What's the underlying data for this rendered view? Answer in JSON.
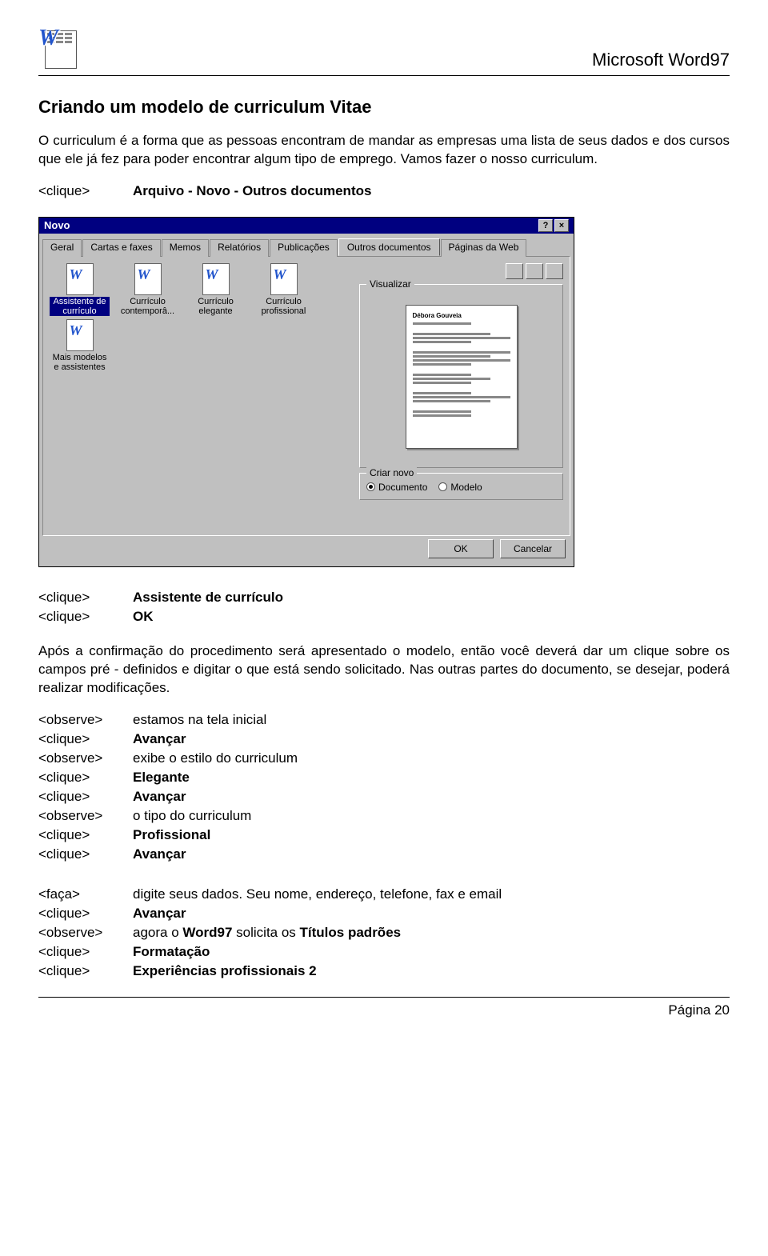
{
  "header": {
    "product": "Microsoft Word97"
  },
  "title": "Criando um modelo de curriculum Vitae",
  "intro": "O curriculum é a forma que as pessoas encontram de mandar as empresas uma lista de seus dados e dos cursos que ele já fez para poder encontrar algum tipo de emprego. Vamos fazer o nosso curriculum.",
  "step1": {
    "tag": "<clique>",
    "val": "Arquivo - Novo - Outros documentos"
  },
  "dialog": {
    "title": "Novo",
    "help_btn": "?",
    "close_btn": "×",
    "tabs": [
      "Geral",
      "Cartas e faxes",
      "Memos",
      "Relatórios",
      "Publicações",
      "Outros documentos",
      "Páginas da Web"
    ],
    "active_tab": 5,
    "templates": [
      {
        "label": "Assistente de currículo",
        "selected": true
      },
      {
        "label": "Currículo contemporâ..."
      },
      {
        "label": "Currículo elegante"
      },
      {
        "label": "Currículo profissional"
      },
      {
        "label": "Mais modelos e assistentes"
      }
    ],
    "preview_label": "Visualizar",
    "preview_name": "Débora Gouveia",
    "create_label": "Criar novo",
    "radio_doc": "Documento",
    "radio_tmpl": "Modelo",
    "ok": "OK",
    "cancel": "Cancelar"
  },
  "step2": [
    {
      "tag": "<clique>",
      "val": "Assistente de currículo",
      "bold": true
    },
    {
      "tag": "<clique>",
      "val": "OK",
      "bold": true
    }
  ],
  "para2": "Após a confirmação do procedimento será apresentado o modelo, então você deverá dar um clique sobre os campos pré - definidos e digitar o que está sendo solicitado. Nas outras partes do documento, se desejar, poderá realizar modificações.",
  "step3": [
    {
      "tag": "<observe>",
      "val": "estamos na tela inicial"
    },
    {
      "tag": "<clique>",
      "val": "Avançar",
      "bold": true
    },
    {
      "tag": "<observe>",
      "val": "exibe o estilo do curriculum"
    },
    {
      "tag": "<clique>",
      "val": "Elegante",
      "bold": true
    },
    {
      "tag": "<clique>",
      "val": "Avançar",
      "bold": true
    },
    {
      "tag": "<observe>",
      "val": "o tipo do curriculum"
    },
    {
      "tag": "<clique>",
      "val": "Profissional",
      "bold": true
    },
    {
      "tag": "<clique>",
      "val": "Avançar",
      "bold": true
    }
  ],
  "step4": [
    {
      "tag": "<faça>",
      "val": "digite seus dados. Seu nome, endereço, telefone, fax e email"
    },
    {
      "tag": "<clique>",
      "val": "Avançar",
      "bold": true
    },
    {
      "tag": "<observe>",
      "val_prefix": "agora o ",
      "val_bold": "Word97",
      "val_suffix": " solicita os ",
      "val_bold2": "Títulos padrões"
    },
    {
      "tag": "<clique>",
      "val": "Formatação",
      "bold": true
    },
    {
      "tag": "<clique>",
      "val": "Experiências profissionais 2",
      "bold": true
    }
  ],
  "footer": "Página 20"
}
